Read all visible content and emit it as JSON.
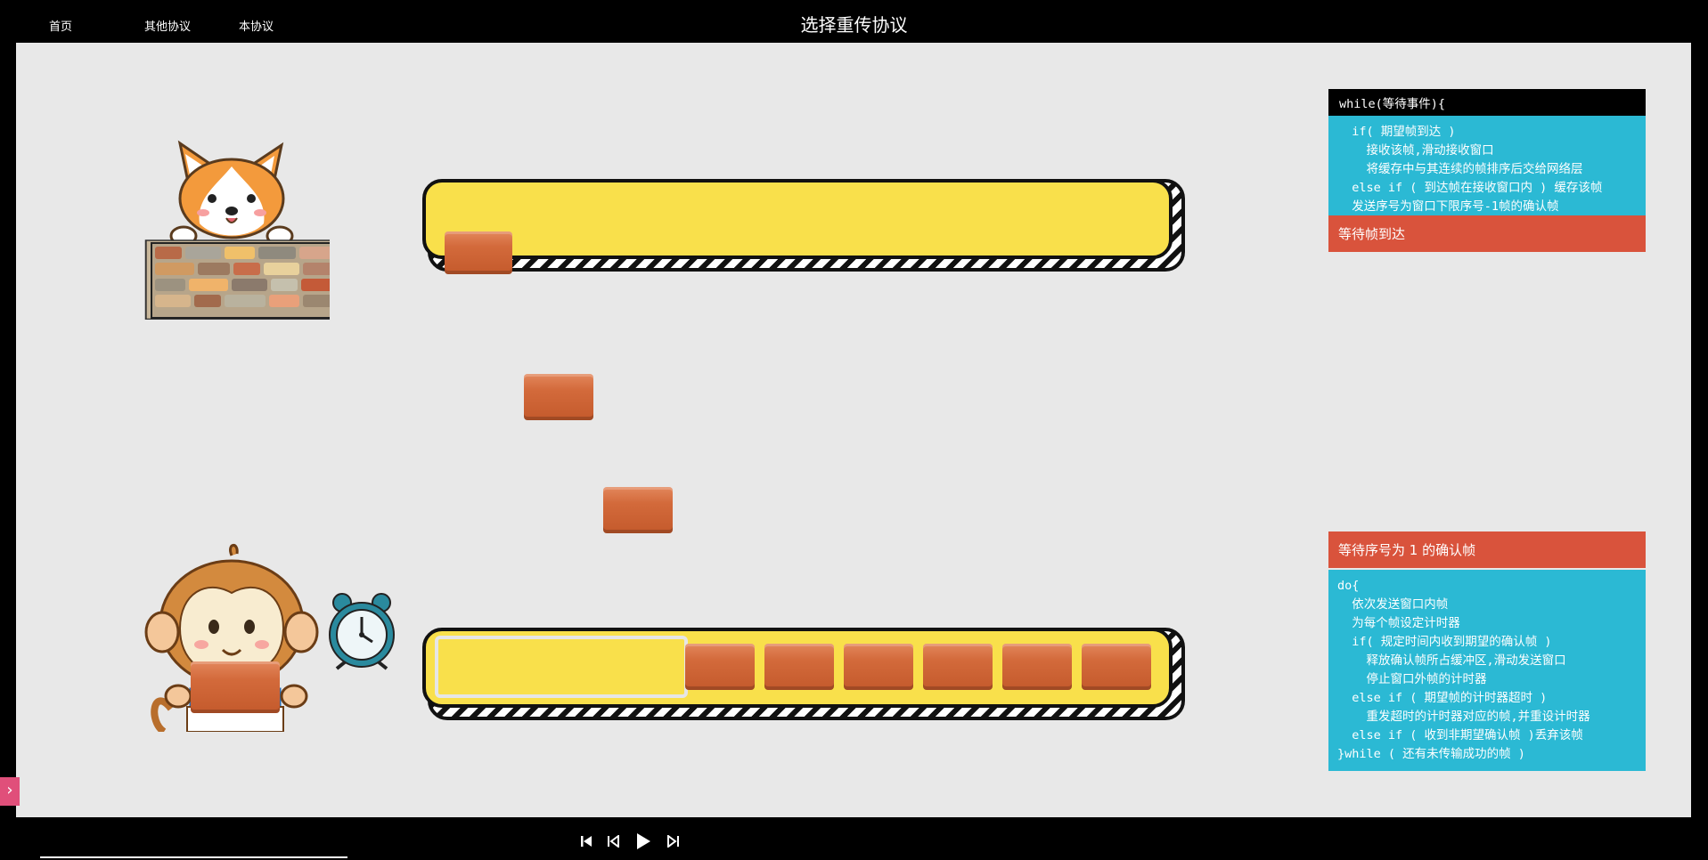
{
  "nav": {
    "home": "首页",
    "other_protocols": "其他协议",
    "this_protocol": "本协议"
  },
  "page_title": "选择重传协议",
  "receiver_panel": {
    "loop_head": "while(等待事件){",
    "code_lines": [
      "  if( 期望帧到达 )",
      "    接收该帧,滑动接收窗口",
      "    将缓存中与其连续的帧排序后交给网络层",
      "  else if ( 到达帧在接收窗口内 ) 缓存该帧",
      "  发送序号为窗口下限序号-1帧的确认帧"
    ],
    "status": "等待帧到达"
  },
  "sender_panel": {
    "status": "等待序号为 1 的确认帧",
    "code_lines": [
      "do{",
      "  依次发送窗口内帧",
      "  为每个帧设定计时器",
      "  if( 规定时间内收到期望的确认帧 )",
      "    释放确认帧所占缓冲区,滑动发送窗口",
      "    停止窗口外帧的计时器",
      "  else if ( 期望帧的计时器超时 )",
      "    重发超时的计时器对应的帧,并重设计时器",
      "  else if ( 收到非期望确认帧 )丢弃该帧",
      "}while ( 还有未传输成功的帧 )"
    ]
  },
  "icons": {
    "receiver": "corgi-on-wall",
    "sender": "monkey-holding-brick",
    "timer": "alarm-clock-icon",
    "first": "skip-to-start-icon",
    "prev": "step-back-icon",
    "play": "play-icon",
    "next": "step-forward-icon",
    "side": "chevron-right-icon"
  },
  "sender_window_frames": 6,
  "colors": {
    "stage_bg": "#e8e8e8",
    "track_yellow": "#f9e04b",
    "code_bg": "#2bb9d4",
    "status_bg": "#d9533c",
    "brick": "#d36a3b",
    "side_toggle": "#e04f7a"
  }
}
